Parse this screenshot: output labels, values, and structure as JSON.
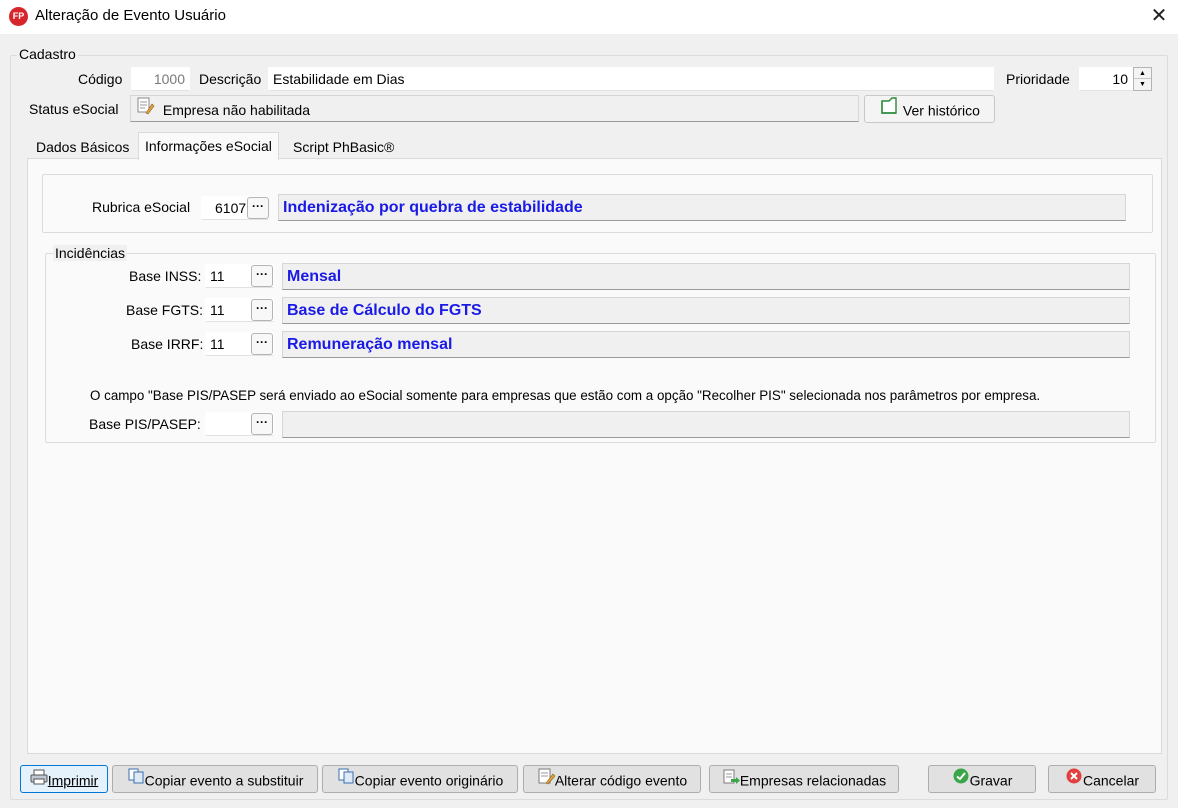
{
  "window": {
    "title": "Alteração de Evento Usuário",
    "app_badge": "FP"
  },
  "cadastro": {
    "group_label": "Cadastro",
    "codigo_label": "Código",
    "codigo_value": "1000",
    "descricao_label": "Descrição",
    "descricao_value": "Estabilidade em Dias",
    "prioridade_label": "Prioridade",
    "prioridade_value": "10",
    "status_label": "Status eSocial",
    "status_value": "Empresa não habilitada",
    "ver_historico": "Ver histórico"
  },
  "tabs": [
    {
      "label": "Dados Básicos",
      "active": false
    },
    {
      "label": "Informações eSocial",
      "active": true
    },
    {
      "label": "Script PhBasic®",
      "active": false
    }
  ],
  "rubrica": {
    "label": "Rubrica eSocial",
    "code": "6107",
    "description": "Indenização por quebra de estabilidade"
  },
  "incidencias": {
    "group_label": "Incidências",
    "rows": [
      {
        "label": "Base INSS:",
        "code": "11",
        "description": "Mensal"
      },
      {
        "label": "Base FGTS:",
        "code": "11",
        "description": "Base de Cálculo do FGTS"
      },
      {
        "label": "Base IRRF:",
        "code": "11",
        "description": "Remuneração mensal"
      }
    ],
    "note": "O campo \"Base PIS/PASEP será enviado ao eSocial somente para empresas que estão com a opção \"Recolher PIS\" selecionada nos parâmetros por empresa.",
    "pis_label": "Base PIS/PASEP:",
    "pis_code": "",
    "pis_description": ""
  },
  "footer": {
    "imprimir": "Imprimir",
    "copiar_substituir": "Copiar evento a substituir",
    "copiar_originario": "Copiar evento originário",
    "alterar_codigo": "Alterar código evento",
    "empresas_relacionadas": "Empresas relacionadas",
    "gravar": "Gravar",
    "cancelar": "Cancelar"
  },
  "colors": {
    "accent_text": "#1a1ae6",
    "app_icon": "#d7262b",
    "ok_green": "#3aa64a",
    "cancel_red": "#e04040"
  }
}
